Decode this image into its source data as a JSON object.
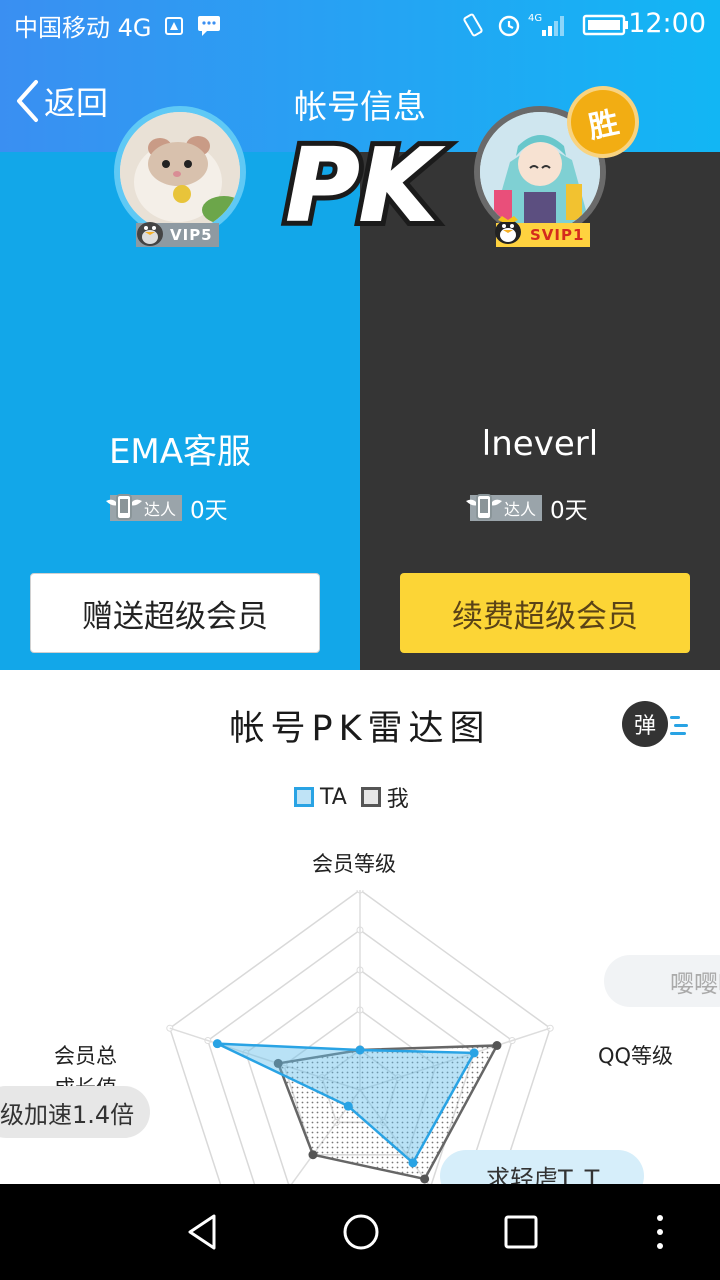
{
  "status_bar": {
    "carrier": "中国移动 4G",
    "time": "12:00",
    "icons": [
      "signal-upload-icon",
      "message-icon",
      "vibrate-icon",
      "alarm-icon",
      "network-4g-icon",
      "battery-icon"
    ]
  },
  "nav": {
    "back_label": "返回",
    "title": "帐号信息"
  },
  "pk": {
    "logo_text": "PK",
    "left": {
      "name": "EMA客服",
      "vip_tag": "VIP5",
      "daren_label": "达人",
      "days": "0天",
      "button": "赠送超级会员"
    },
    "right": {
      "name": "lneverl",
      "vip_tag": "SVIP1",
      "daren_label": "达人",
      "days": "0天",
      "win_badge": "胜",
      "button": "续费超级会员"
    },
    "colors": {
      "left_bg": "#12a7e9",
      "right_bg": "#353535",
      "renew_btn": "#fcd536"
    }
  },
  "radar": {
    "title": "帐号PK雷达图",
    "danmu_button": "弹",
    "legend": [
      {
        "name": "TA",
        "color": "#29a3e4"
      },
      {
        "name": "我",
        "color": "#555555"
      }
    ],
    "axes": {
      "top": "会员等级",
      "right": "QQ等级",
      "left_line1": "会员总",
      "left_line2": "成长值"
    },
    "bubbles": [
      "级加速1.4倍",
      "求轻虐T_T",
      "嘤嘤嘤"
    ]
  },
  "chart_data": {
    "type": "radar",
    "title": "帐号PK雷达图",
    "categories": [
      "会员等级",
      "QQ等级",
      "",
      "",
      "会员总成长值"
    ],
    "series": [
      {
        "name": "TA",
        "values": [
          0.2,
          0.6,
          0.45,
          0.1,
          0.75
        ]
      },
      {
        "name": "我",
        "values": [
          0.2,
          0.72,
          0.55,
          0.4,
          0.43
        ]
      }
    ],
    "ylim": [
      0,
      1
    ]
  }
}
